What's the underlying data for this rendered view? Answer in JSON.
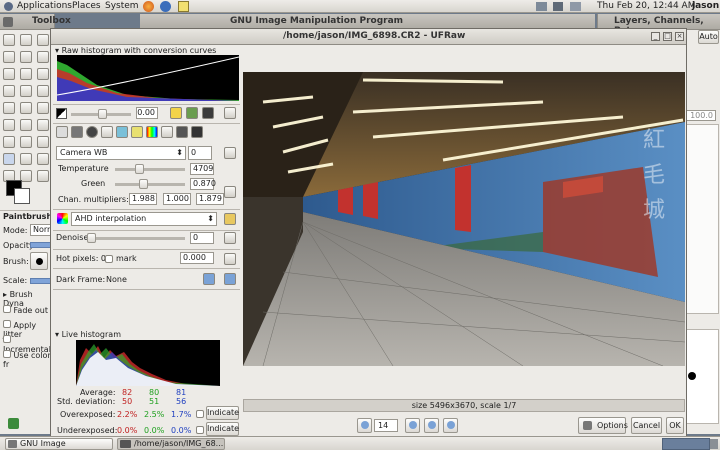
{
  "topbar": {
    "menus": [
      "Applications",
      "Places",
      "System"
    ],
    "clock": "Thu Feb 20, 12:44 AM",
    "user": "jason"
  },
  "toolbox": {
    "title": "Toolbox",
    "tool_name": "Paintbrush",
    "mode_label": "Mode:",
    "mode_value": "Norm",
    "opacity_label": "Opacity:",
    "brush_label": "Brush:",
    "scale_label": "Scale:",
    "options": [
      "Brush Dyna",
      "Fade out",
      "Apply Jitter",
      "Incremental",
      "Use color fr"
    ]
  },
  "gimp": {
    "title": "GNU Image Manipulation Program"
  },
  "layers": {
    "title": "Layers, Channels, Pat",
    "auto_label": "Auto",
    "value": "100.0"
  },
  "ufraw": {
    "title": "/home/jason/IMG_6898.CR2 - UFRaw",
    "raw_hist_label": "Raw histogram with conversion curves",
    "exposure_value": "0.00",
    "wb_select": "Camera WB",
    "wb_finetune": "0",
    "temp_label": "Temperature",
    "temp_value": "4709",
    "green_label": "Green",
    "green_value": "0.870",
    "chan_label": "Chan. multipliers:",
    "chan_values": [
      "1.988",
      "1.000",
      "1.879"
    ],
    "interp_select": "AHD interpolation",
    "denoise_label": "Denoise",
    "denoise_value": "0",
    "hot_label": "Hot pixels: 0",
    "mark_label": "mark",
    "hot_value": "0.000",
    "dark_label": "Dark Frame:",
    "dark_value": "None",
    "live_hist_label": "Live histogram",
    "stats": {
      "avg_label": "Average:",
      "avg": [
        "82",
        "80",
        "81"
      ],
      "std_label": "Std. deviation:",
      "std": [
        "50",
        "51",
        "56"
      ],
      "over_label": "Overexposed:",
      "over": [
        "2.2%",
        "2.5%",
        "1.7%"
      ],
      "under_label": "Underexposed:",
      "under": [
        "0.0%",
        "0.0%",
        "0.0%"
      ],
      "indicate": "Indicate"
    },
    "image_size": "size 5496x3670, scale 1/7",
    "zoom_value": "14",
    "options_btn": "Options",
    "cancel_btn": "Cancel",
    "ok_btn": "OK",
    "sign_text": [
      "紅",
      "毛",
      "城"
    ]
  },
  "taskbar": {
    "items": [
      "GNU Image Manipula...",
      "/home/jason/IMG_68..."
    ]
  }
}
